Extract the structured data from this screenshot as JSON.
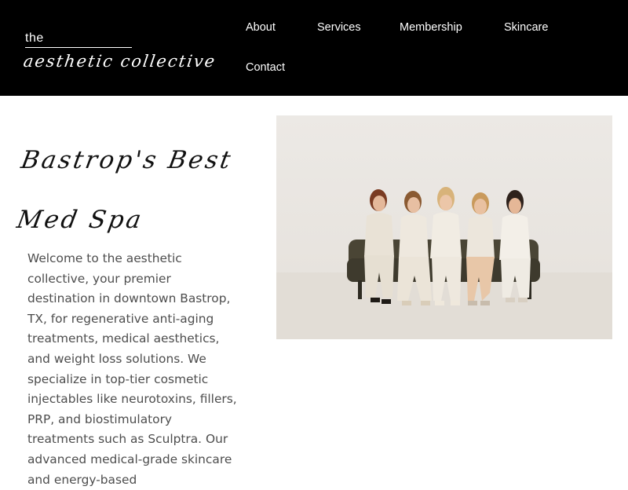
{
  "header": {
    "logo": {
      "the": "the",
      "script": "aesthetic collective"
    },
    "nav": [
      {
        "label": "About"
      },
      {
        "label": "Services"
      },
      {
        "label": "Membership"
      },
      {
        "label": "Skincare"
      },
      {
        "label": "Contact"
      }
    ],
    "background_color": "#000000"
  },
  "hero": {
    "heading_line1": "Bastrop's Best",
    "heading_line2": "Med Spa",
    "body": "Welcome to the aesthetic collective, your premier destination in downtown Bastrop, TX, for regenerative anti-aging treatments, medical aesthetics, and weight loss solutions. We specialize in top-tier cosmetic injectables like neurotoxins, fillers, PRP, and biostimulatory treatments such as Sculptra. Our advanced medical-grade skincare and energy-based"
  }
}
